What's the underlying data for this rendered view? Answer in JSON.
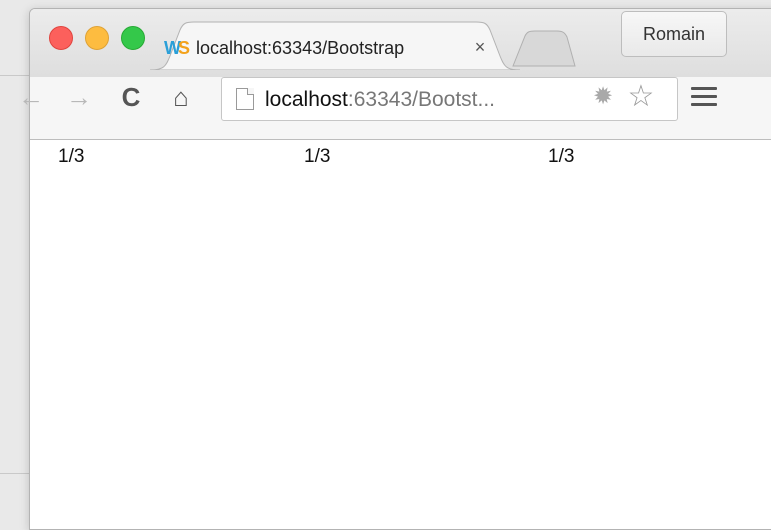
{
  "browser": {
    "tab": {
      "title": "localhost:63343/Bootstrap",
      "close_glyph": "×",
      "favicon_letters": [
        "W",
        "S"
      ],
      "favicon_colors": [
        "#2a9fd8",
        "#f3a21c"
      ]
    },
    "profile_label": "Romain",
    "toolbar": {
      "back_glyph": "←",
      "forward_glyph": "→",
      "reload_glyph": "C",
      "home_glyph": "⌂"
    },
    "omnibox": {
      "url_host": "localhost",
      "url_rest": ":63343/Bootst...",
      "ext_glyph": "✹",
      "star_glyph": "☆"
    },
    "icons": {
      "back": "back-arrow-icon",
      "forward": "forward-arrow-icon",
      "reload": "reload-icon",
      "home": "home-icon",
      "page": "page-icon",
      "extension": "extension-icon",
      "star": "bookmark-star-icon",
      "menu": "hamburger-menu-icon"
    },
    "traffic_colors": {
      "close": "#fc605c",
      "minimize": "#fdbc40",
      "maximize": "#34c84a"
    }
  },
  "page": {
    "columns": [
      "1/3",
      "1/3",
      "1/3"
    ]
  }
}
